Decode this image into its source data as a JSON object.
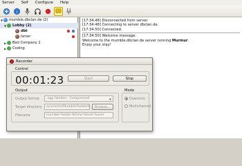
{
  "menu": [
    "Server",
    "Self",
    "Configure",
    "Help"
  ],
  "toolbar": {
    "icons": [
      "connect-icon",
      "info-icon",
      "mute-self-icon",
      "deafen-self-icon",
      "record-icon",
      "comment-icon",
      "plugin-icon"
    ]
  },
  "tree": {
    "server": "mumble.dbclan.de (2)",
    "channels": [
      {
        "name": "Lobby (2)",
        "users": [
          "dbt",
          "Ismer"
        ]
      },
      {
        "name": "Bad Company 2"
      },
      {
        "name": "Coding"
      }
    ]
  },
  "log": [
    "[17:34:48] Disconnected from server.",
    "[17:34:48] Connecting to server dbclan.de.",
    "[17:34:50] Connected.",
    "[17:34:50] Welcome message:",
    "Welcome to the mumble.dbclan.de server running ",
    "Murmur",
    ".",
    "Enjoy your stay!"
  ],
  "recorder": {
    "title": "Recorder",
    "control_label": "Control",
    "timer": "00:01:23",
    "start_label": "Start",
    "stop_label": "Stop",
    "output_label": "Output",
    "format_label": "Output format",
    "format_value": ".ogg (Vorbis) - Compressed",
    "dir_label": "Target directory",
    "dir_value": "ocuments\\Mumble\\%date%",
    "browse_label": "Browse...",
    "filename_label": "Filename",
    "filename_value": "mumble-%date-%time-%host-%user",
    "mode_label": "Mode",
    "mode_downmix": "Downmix",
    "mode_multichannel": "Multichannel",
    "mode_selected": "Downmix"
  },
  "colors": {
    "record": "#d22222",
    "selection": "#dfe6f3"
  }
}
